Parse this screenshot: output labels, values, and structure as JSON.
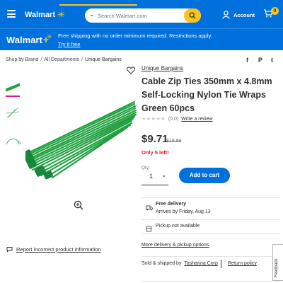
{
  "header": {
    "logo_text": "Walmart",
    "search_placeholder": "Search Walmart.com",
    "account_label": "Account",
    "cart_count": "0"
  },
  "banner": {
    "logo_text": "Walmart",
    "text": "Free shipping with no order minimum required. Restrictions apply.",
    "link": "Try it free"
  },
  "breadcrumb": [
    "Shop by Brand",
    "All Departments",
    "Unique Bargains"
  ],
  "product": {
    "seller_link": "Unique Bargains",
    "title": "Cable Zip Ties 350mm x 4.8mm Self-Locking Nylon Tie Wraps Green 60pcs",
    "rating_count": "(0.0)",
    "review_link": "Write a review",
    "price": "$9.71",
    "was_price": "$19.99",
    "stock": "Only 5 left!",
    "qty_label": "Qty:",
    "qty_value": "1",
    "add_to_cart": "Add to cart"
  },
  "delivery": {
    "free_delivery": "Free delivery",
    "arrives": "Arrives by Friday, Aug 13",
    "pickup": "Pickup not available",
    "more_options": "More delivery & pickup options"
  },
  "seller": {
    "sold_by_label": "Sold & shipped by",
    "seller_name": "Tasharina Corp",
    "return_policy": "Return policy"
  },
  "report_link": "Report incorrect product information",
  "feedback_label": "Feedback",
  "share_icons": [
    "f",
    "P",
    "t"
  ],
  "colors": {
    "brand_blue": "#0071dc",
    "spark_yellow": "#ffc220",
    "stock_red": "#de1c24",
    "product_green": "#1f9e3e"
  }
}
